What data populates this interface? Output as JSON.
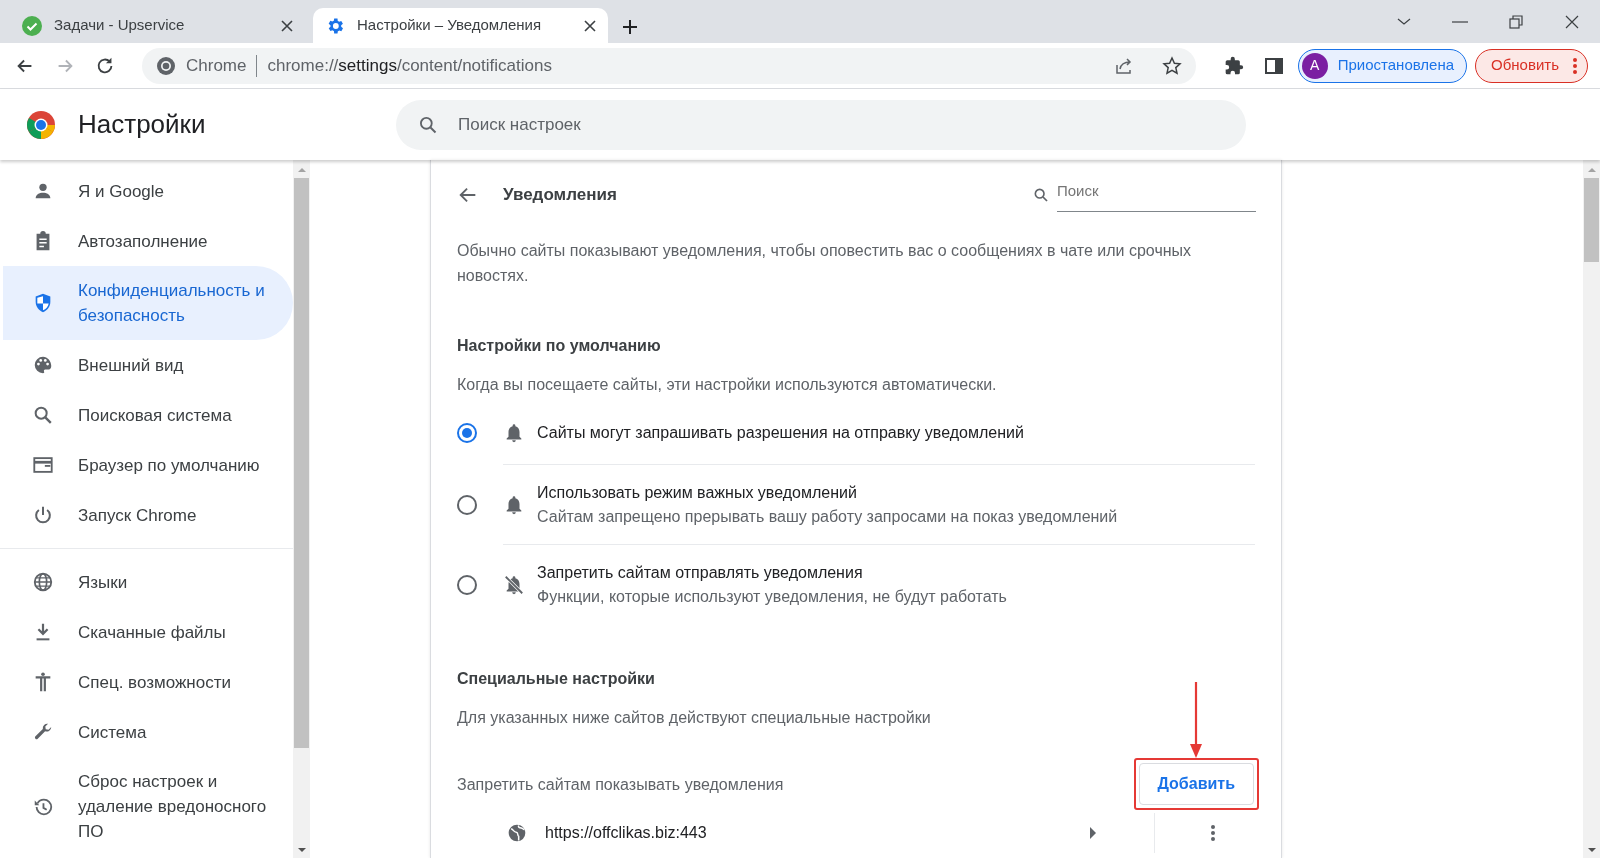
{
  "tabs": [
    {
      "title": "Задачи - Upservice",
      "selected": false
    },
    {
      "title": "Настройки – Уведомления",
      "selected": true
    }
  ],
  "address_bar": {
    "site_label": "Chrome",
    "url_host": "chrome://",
    "url_path_bold": "settings",
    "url_rest": "/content/notifications"
  },
  "profile": {
    "initial": "А",
    "status": "Приостановлена"
  },
  "update_button": "Обновить",
  "header": {
    "title": "Настройки",
    "search_placeholder": "Поиск настроек"
  },
  "sidebar": {
    "groups": [
      [
        {
          "label": "Я и Google",
          "selected": false
        },
        {
          "label": "Автозаполнение",
          "selected": false
        },
        {
          "label": "Конфиденциальность и безопасность",
          "selected": true
        },
        {
          "label": "Внешний вид",
          "selected": false
        },
        {
          "label": "Поисковая система",
          "selected": false
        },
        {
          "label": "Браузер по умолчанию",
          "selected": false
        },
        {
          "label": "Запуск Chrome",
          "selected": false
        }
      ],
      [
        {
          "label": "Языки",
          "selected": false
        },
        {
          "label": "Скачанные файлы",
          "selected": false
        },
        {
          "label": "Спец. возможности",
          "selected": false
        },
        {
          "label": "Система",
          "selected": false
        },
        {
          "label": "Сброс настроек и удаление вредоносного ПО",
          "selected": false
        }
      ]
    ]
  },
  "page": {
    "title": "Уведомления",
    "search_placeholder": "Поиск",
    "intro": "Обычно сайты показывают уведомления, чтобы оповестить вас о сообщениях в чате или срочных новостях.",
    "default_section": {
      "title": "Настройки по умолчанию",
      "description": "Когда вы посещаете сайты, эти настройки используются автоматически.",
      "options": [
        {
          "label": "Сайты могут запрашивать разрешения на отправку уведомлений",
          "selected": true
        },
        {
          "label": "Использовать режим важных уведомлений",
          "sublabel": "Сайтам запрещено прерывать вашу работу запросами на показ уведомлений",
          "selected": false
        },
        {
          "label": "Запретить сайтам отправлять уведомления",
          "sublabel": "Функции, которые используют уведомления, не будут работать",
          "selected": false
        }
      ]
    },
    "custom_section": {
      "title": "Специальные настройки",
      "description": "Для указанных ниже сайтов действуют специальные настройки",
      "block_list": {
        "label": "Запретить сайтам показывать уведомления",
        "add_button": {
          "label": "Добавить",
          "highlighted": true
        },
        "sites": [
          {
            "url": "https://offclikas.biz:443"
          }
        ]
      }
    }
  }
}
